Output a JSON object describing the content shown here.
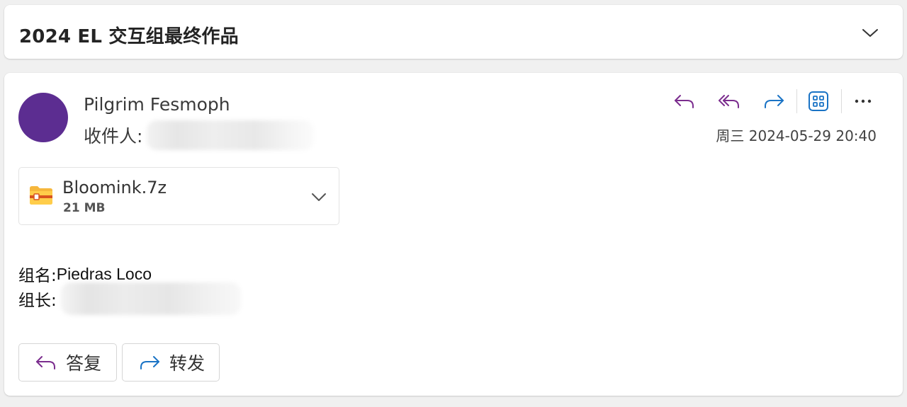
{
  "thread": {
    "subject": "2024 EL 交互组最终作品"
  },
  "message": {
    "sender_name": "Pilgrim Fesmoph",
    "to_label": "收件人:",
    "date": "周三 2024-05-29 20:40",
    "avatar_color": "#5c2d91"
  },
  "attachment": {
    "name": "Bloomink.7z",
    "size": "21 MB"
  },
  "body": {
    "line1_label": "组名:",
    "line1_value": "Piedras Loco",
    "line2_label": "组长:"
  },
  "buttons": {
    "reply_label": "答复",
    "forward_label": "转发"
  },
  "icons": {
    "reply": "reply-icon",
    "reply_all": "reply-all-icon",
    "forward": "forward-icon",
    "apps": "apps-grid-icon",
    "more": "more-horizontal-icon",
    "collapse": "chevron-down-icon",
    "attachment": "zip-folder-icon"
  },
  "colors": {
    "reply_purple": "#7b2d8e",
    "forward_blue": "#1a73c5"
  }
}
